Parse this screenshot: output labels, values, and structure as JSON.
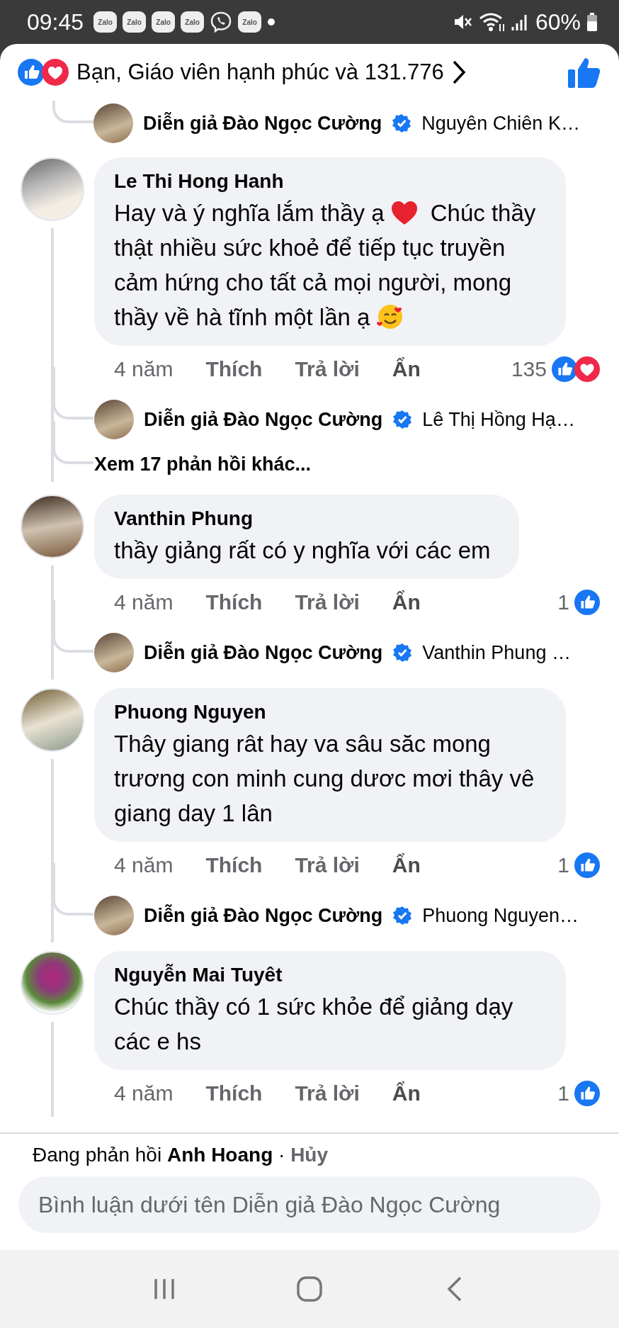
{
  "status_bar": {
    "time": "09:45",
    "apps": [
      {
        "kind": "zalo",
        "label": "Zalo"
      },
      {
        "kind": "zalo",
        "label": "Zalo"
      },
      {
        "kind": "zalo",
        "label": "Zalo"
      },
      {
        "kind": "zalo",
        "label": "Zalo"
      },
      {
        "kind": "viber"
      },
      {
        "kind": "zalo",
        "label": "Zalo"
      }
    ],
    "battery": "60%"
  },
  "reactions_header": {
    "liked": true,
    "loved": true,
    "summary": "Bạn, Giáo viên hạnh phúc và 131.776"
  },
  "top_reply": {
    "author": "Diễn giả Đào Ngọc Cường",
    "preview": "Nguyên Chiên K…"
  },
  "comments": [
    {
      "author": "Le Thi Hong Hanh",
      "segments": [
        {
          "text": "Hay và ý nghĩa lắm thầy ạ",
          "heart": true
        },
        {
          "text": "Chúc thầy thật nhiều sức khoẻ để tiếp tục truyền cảm hứng cho tất cả mọi người, mong thầy về hà tĩnh một lần ạ",
          "smiley": true
        }
      ],
      "time": "4 năm",
      "like": "Thích",
      "reply": "Trả lời",
      "hide": "Ẩn",
      "count": "135",
      "liked": true,
      "loved": true,
      "replies": [
        {
          "author": "Diễn giả Đào Ngọc Cường",
          "preview": "Lê Thị Hồng Hạ…"
        }
      ],
      "more": "Xem 17 phản hồi khác..."
    },
    {
      "author": "Vanthin Phung",
      "segments": [
        {
          "text": "thầy giảng rất có y nghĩa với các em"
        }
      ],
      "time": "4 năm",
      "like": "Thích",
      "reply": "Trả lời",
      "hide": "Ẩn",
      "count": "1",
      "liked": true,
      "replies": [
        {
          "author": "Diễn giả Đào Ngọc Cường",
          "preview": "Vanthin Phung …"
        }
      ]
    },
    {
      "author": "Phuong Nguyen",
      "segments": [
        {
          "text": "Thây giang rât hay va sâu săc mong trương con minh cung dươc mơi thây vê giang day 1 lân"
        }
      ],
      "time": "4 năm",
      "like": "Thích",
      "reply": "Trả lời",
      "hide": "Ẩn",
      "count": "1",
      "liked": true,
      "replies": [
        {
          "author": "Diễn giả Đào Ngọc Cường",
          "preview": "Phuong Nguyen…"
        }
      ]
    },
    {
      "author": "Nguyễn Mai Tuyêt",
      "segments": [
        {
          "text": "Chúc thầy có 1 sức khỏe để giảng dạy các e hs"
        }
      ],
      "time": "4 năm",
      "like": "Thích",
      "reply": "Trả lời",
      "hide": "Ẩn",
      "count": "1",
      "liked": true
    }
  ],
  "composer": {
    "label": "Đang phản hồi",
    "name": "Anh Hoang",
    "separator": "·",
    "cancel": "Hủy",
    "placeholder": "Bình luận dưới tên Diễn giả Đào Ngọc Cường"
  }
}
